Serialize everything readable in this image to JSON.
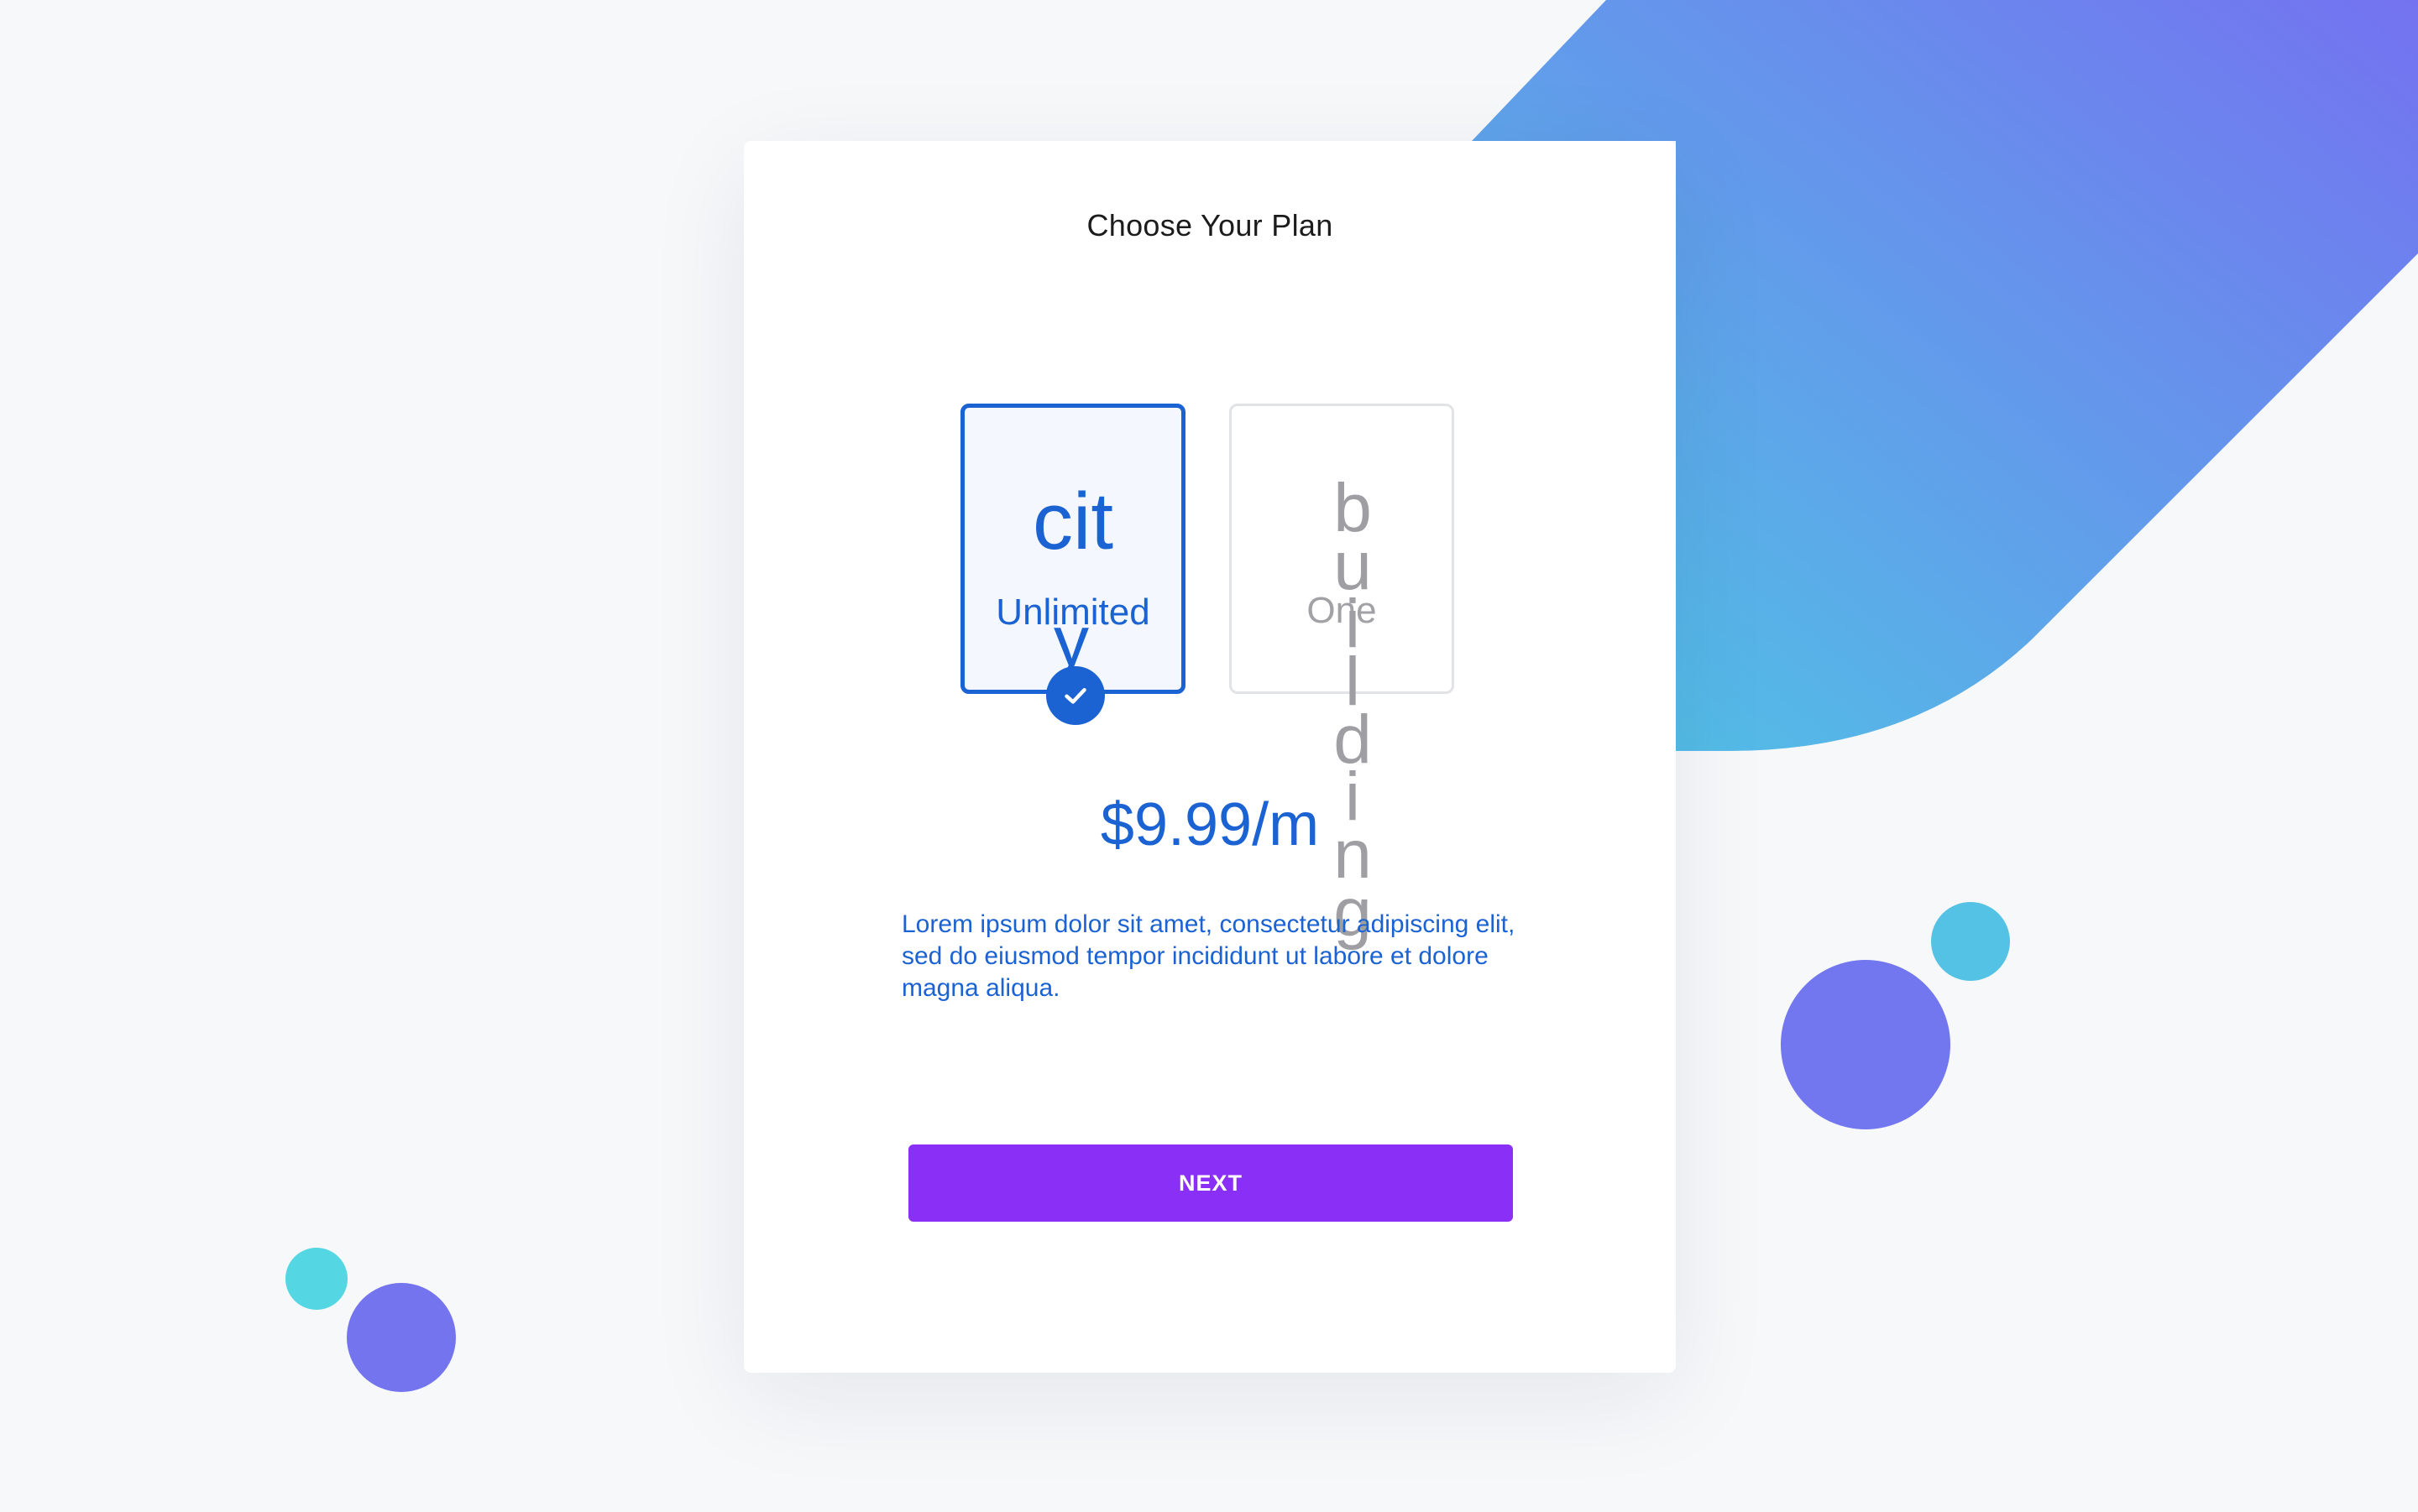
{
  "colors": {
    "background": "#f7f8fa",
    "primary": "#1b62d2",
    "button": "#8a2ff5",
    "blob_start": "#54c2e4",
    "blob_end": "#7472f0"
  },
  "page": {
    "title": "Choose Your Plan"
  },
  "plans": [
    {
      "icon_name": "city-icon",
      "icon_text": "cit",
      "icon_tail": "y",
      "label": "Unlimited",
      "selected": true
    },
    {
      "icon_name": "building-icon",
      "icon_text": "building",
      "label": "One",
      "selected": false
    }
  ],
  "selected_check_icon": "check-icon",
  "price": "$9.99/m",
  "description": "Lorem ipsum dolor sit amet, consectetur adipiscing elit, sed do eiusmod tempor incididunt ut labore et dolore magna aliqua.",
  "next_button": {
    "label": "NEXT"
  }
}
